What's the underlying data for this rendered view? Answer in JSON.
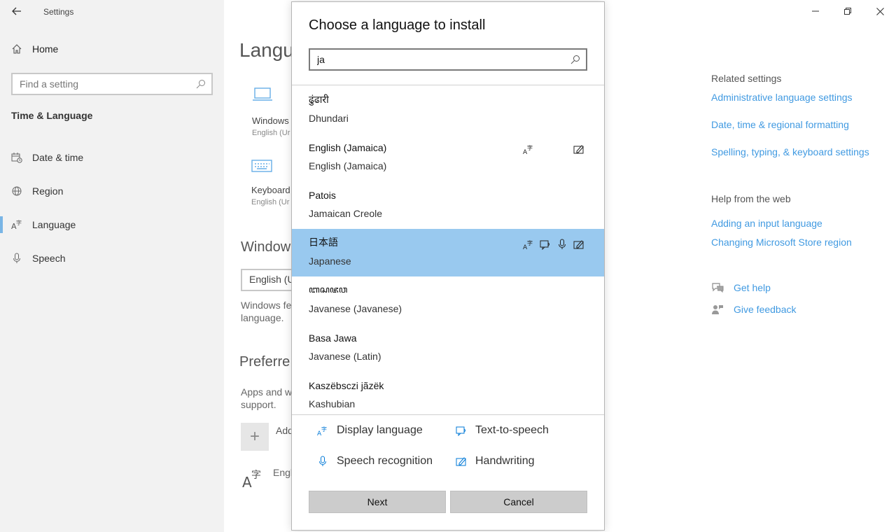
{
  "app": {
    "title": "Settings"
  },
  "sidebar": {
    "home_label": "Home",
    "search_placeholder": "Find a setting",
    "section_title": "Time & Language",
    "items": [
      {
        "label": "Date & time",
        "icon": "calendar-clock-icon"
      },
      {
        "label": "Region",
        "icon": "globe-icon"
      },
      {
        "label": "Language",
        "icon": "language-icon",
        "active": true
      },
      {
        "label": "Speech",
        "icon": "microphone-icon"
      }
    ]
  },
  "main": {
    "heading": "Langu",
    "tiles": [
      {
        "label": "Windows",
        "sub": "English (Ur",
        "icon": "laptop-icon"
      },
      {
        "label": "Keyboard",
        "sub": "English (Ur",
        "icon": "keyboard-icon"
      }
    ],
    "windows_heading": "Window",
    "display_language_value": "English (U",
    "windows_note_1": "Windows fe",
    "windows_note_2": "language.",
    "preferred_heading": "Preferre",
    "apps_note_1": "Apps and w",
    "apps_note_2": "support.",
    "add_label": "Add",
    "pref_lang_label": "Engl"
  },
  "right_panel": {
    "related_heading": "Related settings",
    "related_links": [
      "Administrative language settings",
      "Date, time & regional formatting",
      "Spelling, typing, & keyboard settings"
    ],
    "help_heading": "Help from the web",
    "help_links": [
      "Adding an input language",
      "Changing Microsoft Store region"
    ],
    "get_help": "Get help",
    "give_feedback": "Give feedback"
  },
  "dialog": {
    "title": "Choose a language to install",
    "search_value": "ja",
    "languages": [
      {
        "native": "ढुंढारी",
        "english": "Dhundari",
        "features": []
      },
      {
        "native": "English (Jamaica)",
        "english": "English (Jamaica)",
        "features": [
          "display-language-icon",
          "handwriting-icon"
        ]
      },
      {
        "native": "Patois",
        "english": "Jamaican Creole",
        "features": []
      },
      {
        "native": "日本語",
        "english": "Japanese",
        "features": [
          "display-language-icon",
          "text-to-speech-icon",
          "speech-recognition-icon",
          "handwriting-icon"
        ],
        "selected": true
      },
      {
        "native": "ꦧꦱꦗꦮ",
        "english": "Javanese (Javanese)",
        "features": []
      },
      {
        "native": "Basa Jawa",
        "english": "Javanese (Latin)",
        "features": []
      },
      {
        "native": "Kaszëbsczi jãzëk",
        "english": "Kashubian",
        "features": []
      }
    ],
    "legend": {
      "display_language": "Display language",
      "text_to_speech": "Text-to-speech",
      "speech_recognition": "Speech recognition",
      "handwriting": "Handwriting"
    },
    "next_label": "Next",
    "cancel_label": "Cancel"
  },
  "colors": {
    "accent": "#0078d7",
    "selected_row": "#99c9ef"
  }
}
